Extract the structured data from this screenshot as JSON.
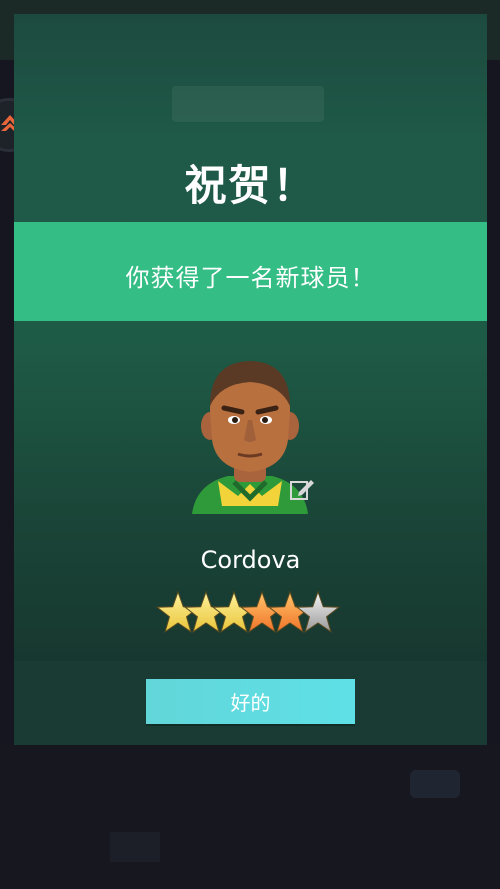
{
  "modal": {
    "title": "祝贺！",
    "message": "你获得了一名新球员！",
    "player_name": "Cordova",
    "rating_stars": 4.5,
    "rating_max": 5,
    "ok_label": "好的"
  },
  "colors": {
    "banner": "#34bd84",
    "button": "#5ee0e6",
    "star_gold": "#f2d44a",
    "star_orange": "#f38a2f",
    "star_empty": "#b8b8b8"
  },
  "icons": [
    "back-arrow-icon",
    "edit-icon",
    "star-icon",
    "app-logo-icon"
  ]
}
